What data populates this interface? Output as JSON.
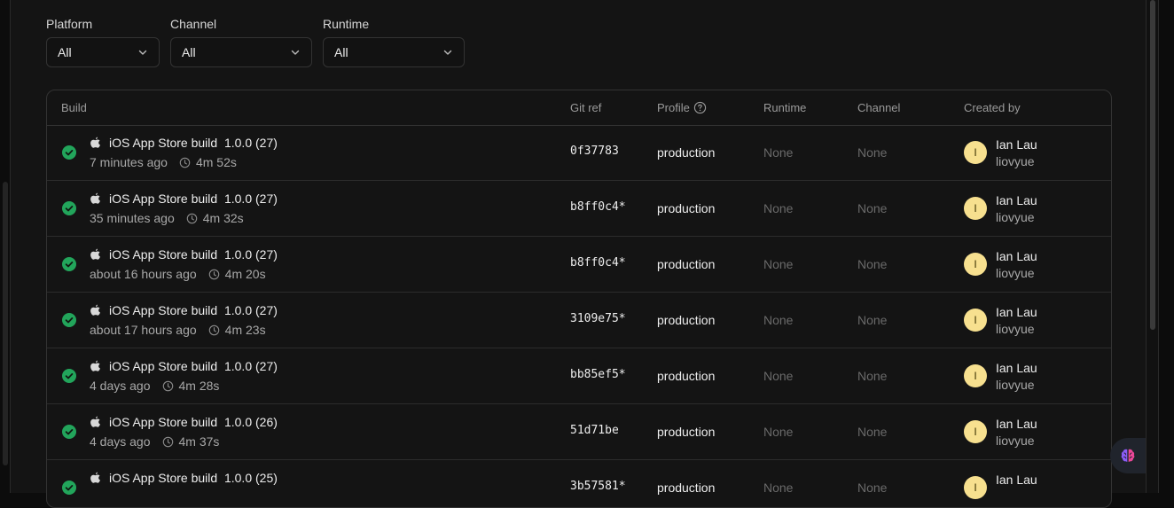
{
  "filters": {
    "platform": {
      "label": "Platform",
      "value": "All"
    },
    "channel": {
      "label": "Channel",
      "value": "All"
    },
    "runtime": {
      "label": "Runtime",
      "value": "All"
    }
  },
  "table": {
    "headers": {
      "build": "Build",
      "git_ref": "Git ref",
      "profile": "Profile",
      "runtime": "Runtime",
      "channel": "Channel",
      "created_by": "Created by"
    },
    "rows": [
      {
        "title": "iOS App Store build  1.0.0 (27)",
        "time": "7 minutes ago",
        "duration": "4m 52s",
        "git_ref": "0f37783",
        "profile": "production",
        "runtime": "None",
        "channel": "None",
        "avatar": "I",
        "user": "Ian Lau",
        "handle": "liovyue"
      },
      {
        "title": "iOS App Store build  1.0.0 (27)",
        "time": "35 minutes ago",
        "duration": "4m 32s",
        "git_ref": "b8ff0c4*",
        "profile": "production",
        "runtime": "None",
        "channel": "None",
        "avatar": "I",
        "user": "Ian Lau",
        "handle": "liovyue"
      },
      {
        "title": "iOS App Store build  1.0.0 (27)",
        "time": "about 16 hours ago",
        "duration": "4m 20s",
        "git_ref": "b8ff0c4*",
        "profile": "production",
        "runtime": "None",
        "channel": "None",
        "avatar": "I",
        "user": "Ian Lau",
        "handle": "liovyue"
      },
      {
        "title": "iOS App Store build  1.0.0 (27)",
        "time": "about 17 hours ago",
        "duration": "4m 23s",
        "git_ref": "3109e75*",
        "profile": "production",
        "runtime": "None",
        "channel": "None",
        "avatar": "I",
        "user": "Ian Lau",
        "handle": "liovyue"
      },
      {
        "title": "iOS App Store build  1.0.0 (27)",
        "time": "4 days ago",
        "duration": "4m 28s",
        "git_ref": "bb85ef5*",
        "profile": "production",
        "runtime": "None",
        "channel": "None",
        "avatar": "I",
        "user": "Ian Lau",
        "handle": "liovyue"
      },
      {
        "title": "iOS App Store build  1.0.0 (26)",
        "time": "4 days ago",
        "duration": "4m 37s",
        "git_ref": "51d71be",
        "profile": "production",
        "runtime": "None",
        "channel": "None",
        "avatar": "I",
        "user": "Ian Lau",
        "handle": "liovyue"
      },
      {
        "title": "iOS App Store build  1.0.0 (25)",
        "time": "",
        "duration": "",
        "git_ref": "3b57581*",
        "profile": "production",
        "runtime": "None",
        "channel": "None",
        "avatar": "I",
        "user": "Ian Lau",
        "handle": ""
      }
    ]
  },
  "colors": {
    "success": "#22a55b",
    "avatar_bg": "#f7e08f",
    "muted_text": "#6a6a6a"
  }
}
